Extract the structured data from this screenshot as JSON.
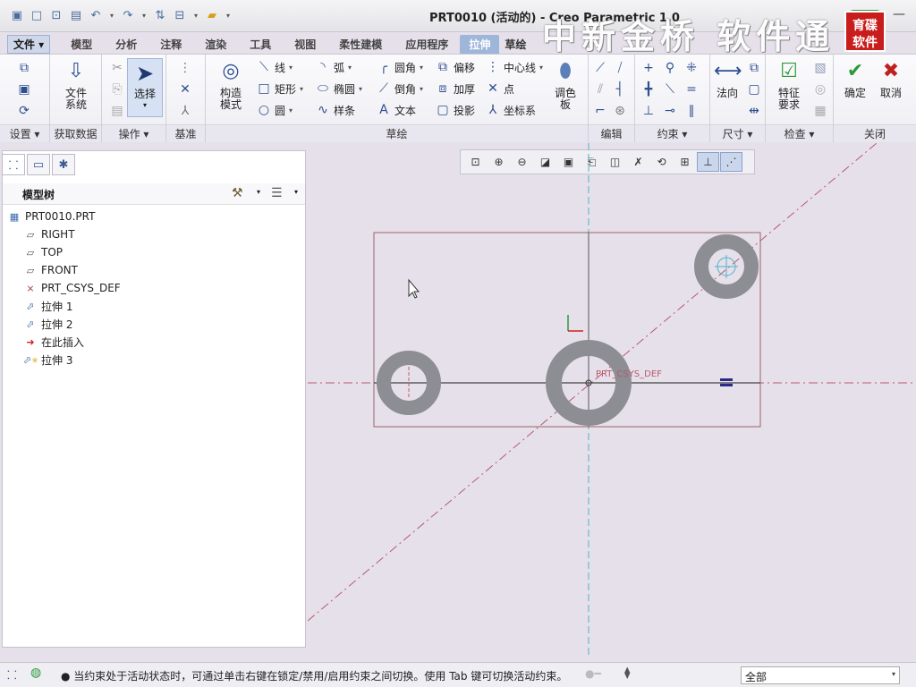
{
  "window": {
    "title": "PRT0010 (活动的) - Creo Parametric 1.0",
    "watermark": "中新金桥  软件通",
    "logo": "育碟\n软件",
    "min_glyph": "—",
    "max_glyph": "❐",
    "close_glyph": "✕"
  },
  "quick_access": [
    "▣",
    "□",
    "📂",
    "💾",
    "↶",
    "▾",
    "↷",
    "▾",
    "⇅",
    "⊟",
    "▾",
    "📁",
    "▾"
  ],
  "menu": {
    "file": "文件 ▾",
    "tabs": [
      "模型",
      "分析",
      "注释",
      "渲染",
      "工具",
      "视图",
      "柔性建模",
      "应用程序"
    ],
    "active_tab": "拉伸",
    "active_sub": "草绘"
  },
  "ribbon": {
    "groups": {
      "setup": "设置 ▾",
      "get_data": "获取数据",
      "operations": "操作 ▾",
      "datum": "基准",
      "sketch": "草绘",
      "edit": "编辑",
      "constrain": "约束 ▾",
      "dimension": "尺寸 ▾",
      "inspect": "检查 ▾",
      "close": "关闭"
    },
    "file_system": "文件\n系统",
    "select": "选择",
    "construct_mode": "构造\n模式",
    "palette": "调色\n板",
    "normal": "法向",
    "feature_req": "特征\n要求",
    "ok": "确定",
    "cancel": "取消",
    "sketch_items": {
      "line": "线",
      "rect": "矩形",
      "circle": "圆",
      "arc": "弧",
      "ellipse": "椭圆",
      "spline": "样条",
      "fillet": "圆角",
      "chamfer": "倒角",
      "text": "文本",
      "offset": "偏移",
      "thicken": "加厚",
      "project": "投影",
      "centerline": "中心线",
      "point": "点",
      "csys": "坐标系"
    }
  },
  "model_tree": {
    "title": "模型树",
    "nodes": [
      "PRT0010.PRT",
      "RIGHT",
      "TOP",
      "FRONT",
      "PRT_CSYS_DEF",
      "拉伸 1",
      "拉伸 2",
      "在此插入",
      "拉伸 3"
    ]
  },
  "canvas": {
    "csys_label": "PRT_CSYS_DEF"
  },
  "status": {
    "message": "● 当约束处于活动状态时，可通过单击右键在锁定/禁用/启用约束之间切换。使用 Tab 键可切换活动约束。按住",
    "filter_value": "全部"
  },
  "colors": {
    "accent": "#9fb6db",
    "sketch_ring": "#8d8d94",
    "centerline": "#4fb3c8",
    "ok_green": "#2c9a3a",
    "cancel_red": "#c02020"
  }
}
